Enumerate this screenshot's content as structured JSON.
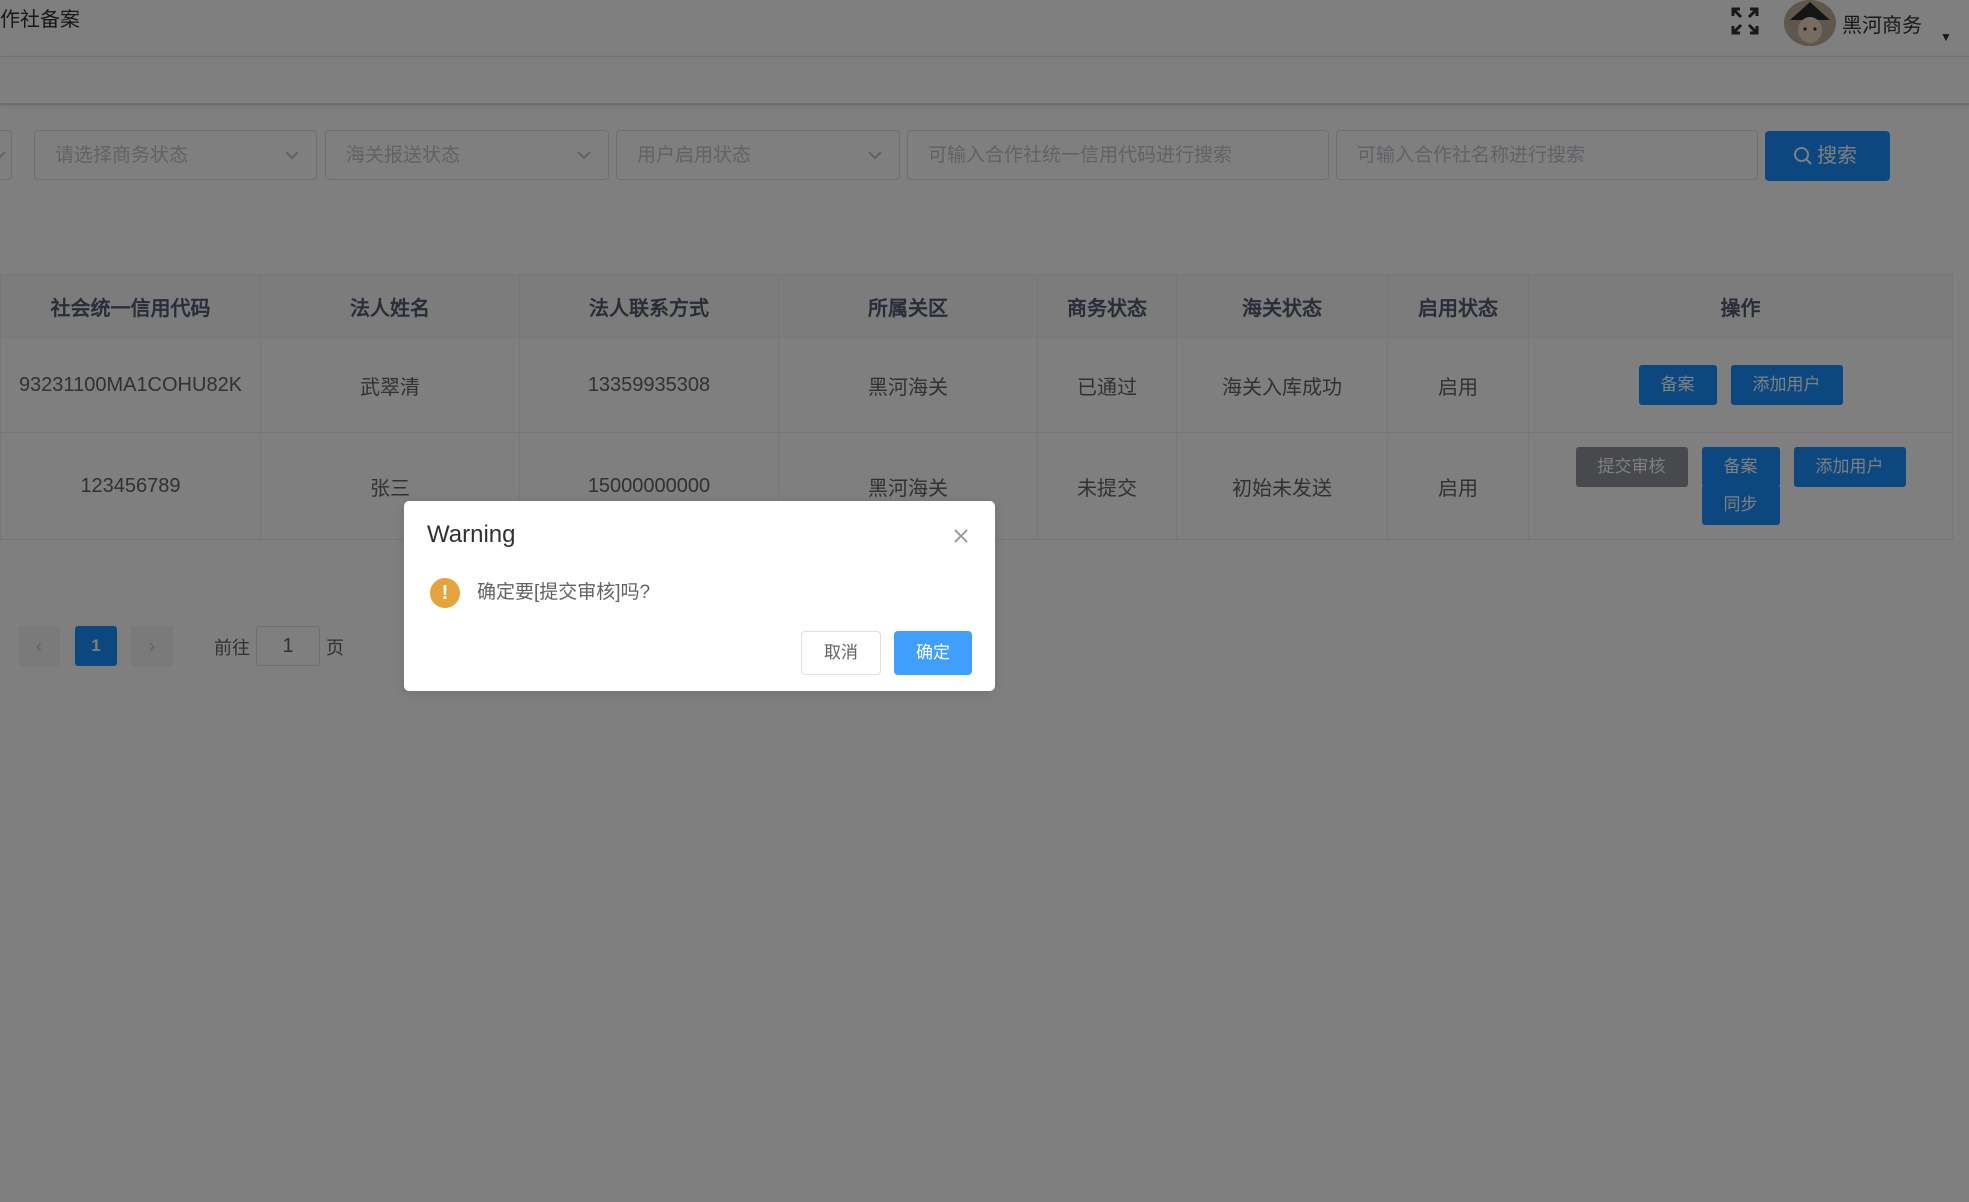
{
  "header": {
    "page_title": "作社备案",
    "user_name": "黑河商务",
    "fullscreen_icon": "fullscreen-icon",
    "caret_icon": "caret-down-icon"
  },
  "filters": {
    "business_status_placeholder": "请选择商务状态",
    "customs_status_placeholder": "海关报送状态",
    "user_status_placeholder": "用户启用状态",
    "credit_code_placeholder": "可输入合作社统一信用代码进行搜索",
    "coop_name_placeholder": "可输入合作社名称进行搜索",
    "search_label": "搜索"
  },
  "table": {
    "headers": [
      "社会统一信用代码",
      "法人姓名",
      "法人联系方式",
      "所属关区",
      "商务状态",
      "海关状态",
      "启用状态",
      "操作"
    ],
    "rows": [
      {
        "credit_code": "93231100MA1COHU82K",
        "legal_name": "武翠清",
        "contact": "13359935308",
        "customs_area": "黑河海关",
        "business_status": "已通过",
        "customs_status": "海关入库成功",
        "enabled": "启用",
        "actions": [
          "备案",
          "添加用户"
        ]
      },
      {
        "credit_code": "123456789",
        "legal_name": "张三",
        "contact": "15000000000",
        "customs_area": "黑河海关",
        "business_status": "未提交",
        "customs_status": "初始未发送",
        "enabled": "启用",
        "actions": [
          "提交审核",
          "备案",
          "添加用户",
          "同步"
        ]
      }
    ]
  },
  "pagination": {
    "current_page": "1",
    "goto_label": "前往",
    "goto_value": "1",
    "page_unit": "页"
  },
  "dialog": {
    "title": "Warning",
    "message": "确定要[提交审核]吗?",
    "cancel_label": "取消",
    "confirm_label": "确定",
    "accent_color": "#409eff",
    "warning_color": "#e6a23c"
  }
}
